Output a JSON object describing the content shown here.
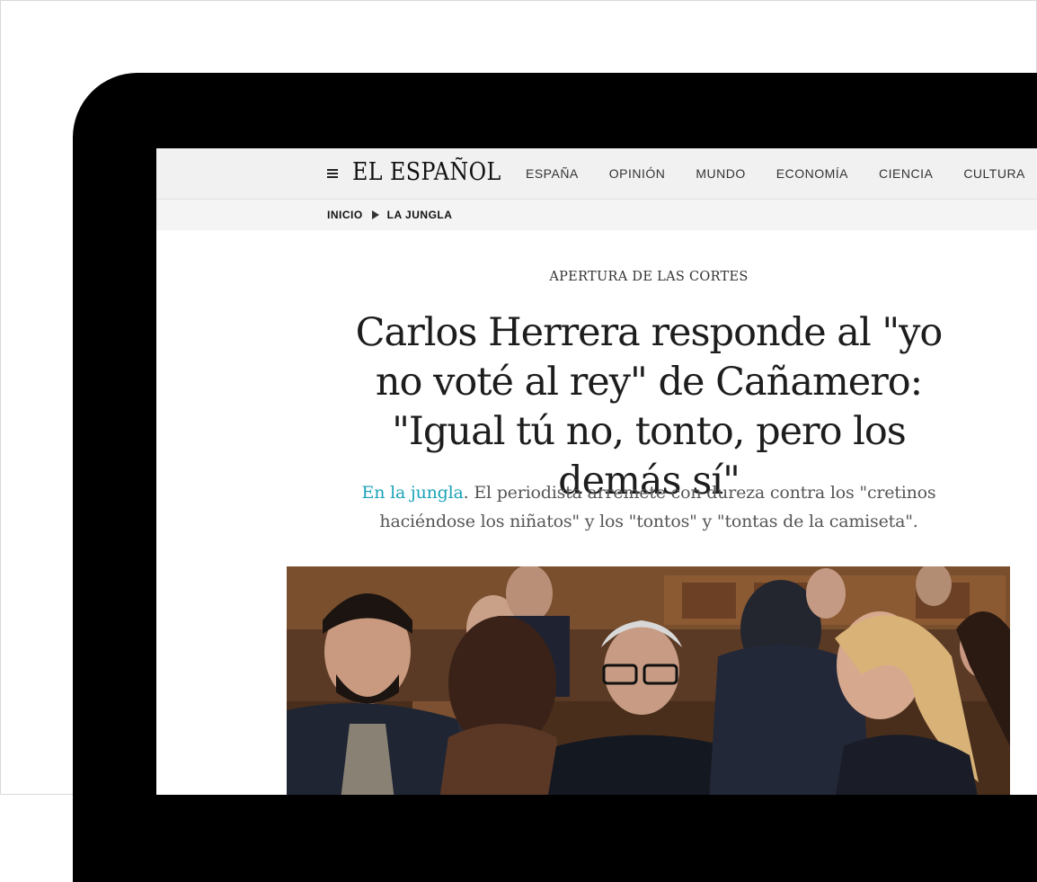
{
  "site": {
    "logo": "EL ESPAÑOL"
  },
  "nav": {
    "items": [
      {
        "label": "ESPAÑA"
      },
      {
        "label": "OPINIÓN"
      },
      {
        "label": "MUNDO"
      },
      {
        "label": "ECONOMÍA"
      },
      {
        "label": "CIENCIA"
      },
      {
        "label": "CULTURA"
      }
    ]
  },
  "breadcrumb": {
    "home": "INICIO",
    "section": "LA JUNGLA"
  },
  "article": {
    "kicker": "APERTURA DE LAS CORTES",
    "headline": "Carlos Herrera responde al \"yo no voté al rey\" de Cañamero: \"Igual tú no, tonto, pero los demás sí\"",
    "standfirst_section": "En la jungla",
    "standfirst_text": ". El periodista arremete con dureza contra los \"cretinos haciéndose los niñatos\" y los \"tontos\" y \"tontas de la camiseta\"."
  },
  "colors": {
    "accent_link": "#1aa3b8",
    "topbar_bg": "#f1f1f1",
    "device_frame": "#000000"
  }
}
